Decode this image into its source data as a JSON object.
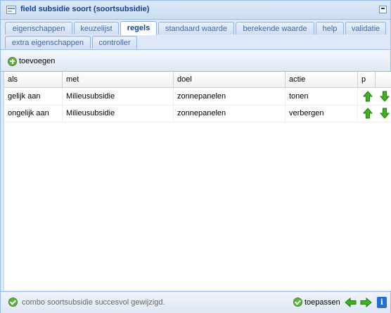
{
  "window": {
    "title": "field subsidie soort (soortsubsidie)"
  },
  "tabs": [
    {
      "label": "eigenschappen"
    },
    {
      "label": "keuzelijst"
    },
    {
      "label": "regels"
    },
    {
      "label": "standaard waarde"
    },
    {
      "label": "berekende waarde"
    },
    {
      "label": "help"
    },
    {
      "label": "validatie"
    },
    {
      "label": "extra eigenschappen"
    },
    {
      "label": "controller"
    }
  ],
  "active_tab": "regels",
  "toolbar": {
    "add_label": "toevoegen"
  },
  "grid": {
    "columns": [
      "als",
      "met",
      "doel",
      "actie",
      "p"
    ],
    "rows": [
      {
        "als": "gelijk aan",
        "met": "Milieusubsidie",
        "doel": "zonnepanelen",
        "actie": "tonen"
      },
      {
        "als": "ongelijk aan",
        "met": "Milieusubsidie",
        "doel": "zonnepanelen",
        "actie": "verbergen"
      }
    ]
  },
  "status": {
    "message": "combo soortsubsidie succesvol gewijzigd.",
    "apply_label": "toepassen",
    "info_label": "i"
  },
  "colors": {
    "arrow_green": "#3cb41c",
    "accent_blue": "#15428b",
    "info_blue": "#1e6fd9"
  },
  "icons": [
    "window-icon",
    "minimize-icon",
    "add-icon",
    "move-up-icon",
    "move-down-icon",
    "success-icon",
    "apply-icon",
    "back-icon",
    "forward-icon",
    "info-icon"
  ]
}
